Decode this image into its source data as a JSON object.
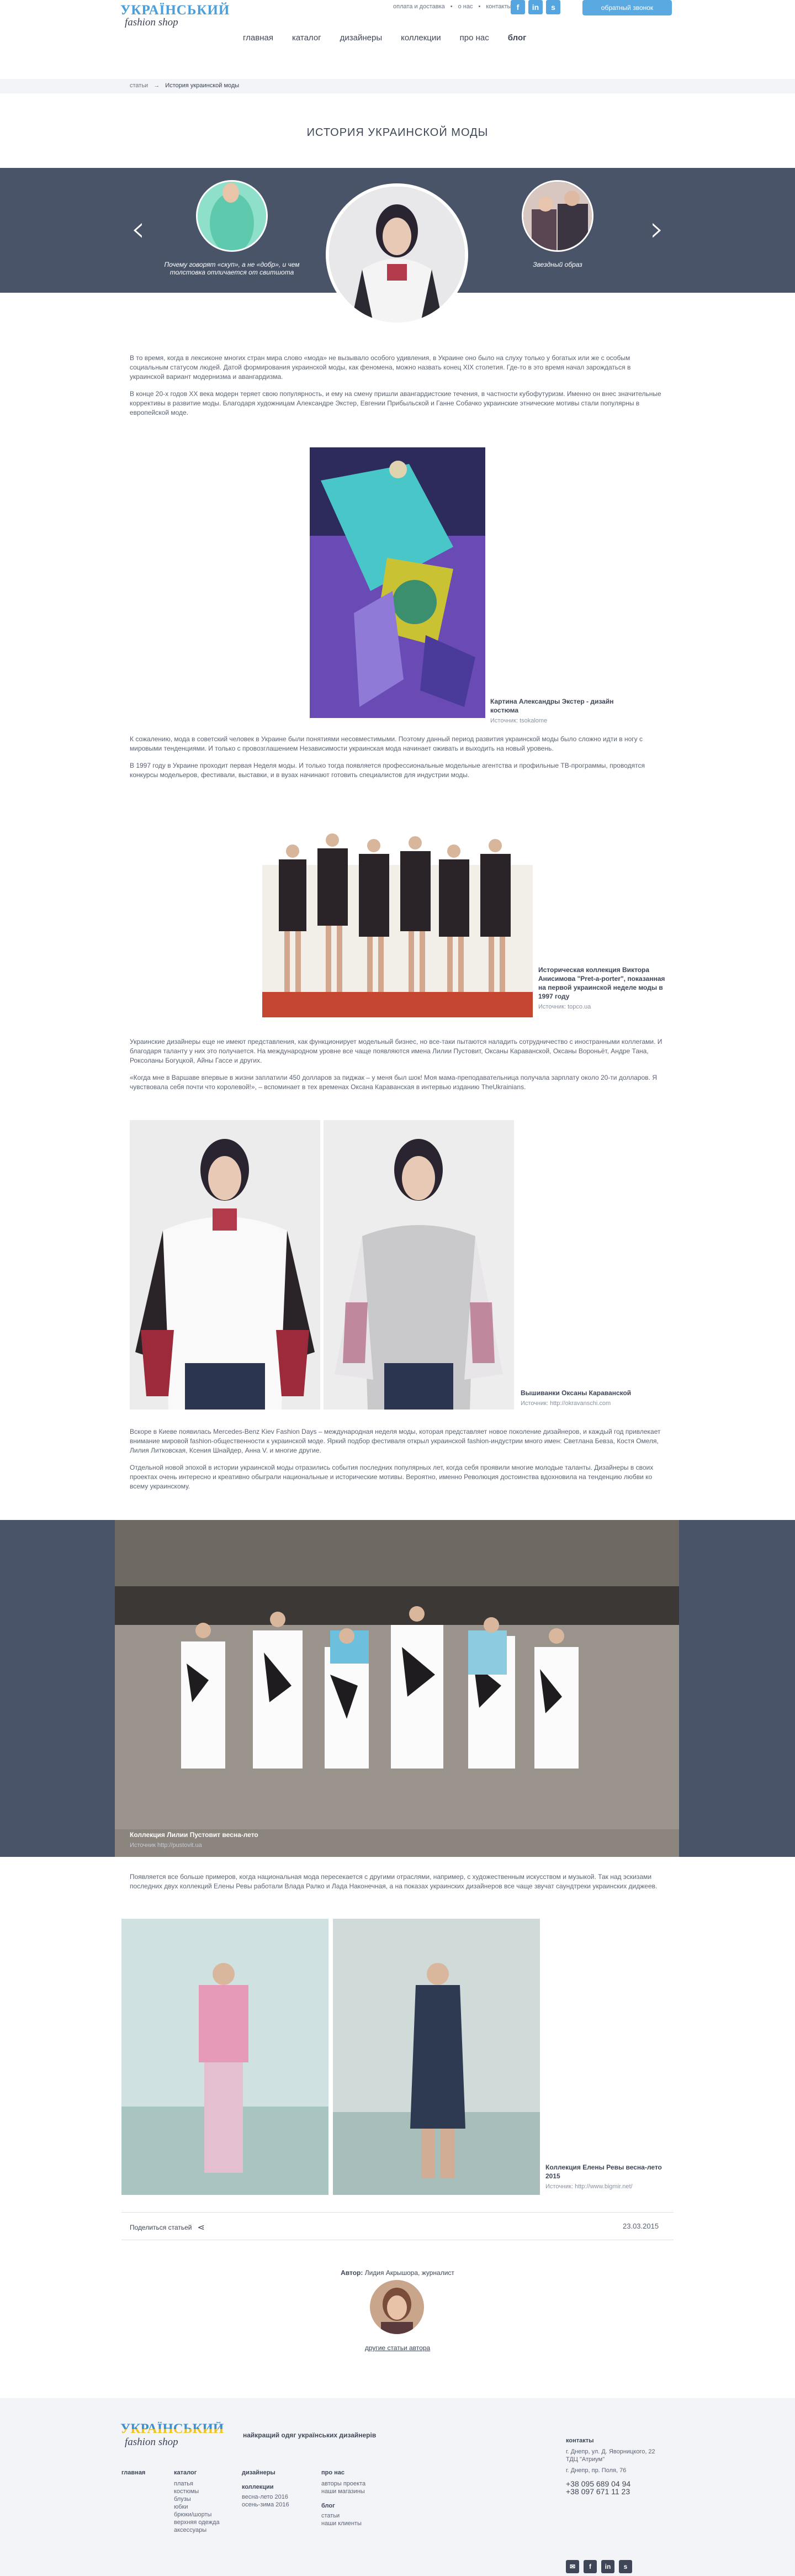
{
  "header": {
    "links": [
      "оплата и доставка",
      "о нас",
      "контакты"
    ],
    "callback_label": "обратный звонок",
    "social": [
      "f",
      "in",
      "s"
    ],
    "logo_line1": "УКРАЇНСЬКИЙ",
    "logo_line2": "fashion shop",
    "nav": [
      "главная",
      "каталог",
      "дизайнеры",
      "коллекции",
      "про нас",
      "блог"
    ]
  },
  "breadcrumb": {
    "root": "статьи",
    "current": "История украинской моды"
  },
  "page_title": "ИСТОРИЯ УКРАИНСКОЙ МОДЫ",
  "slider": {
    "prev_caption": "Почему говорят «скуп», а не «добр», и чем толстовка отличается от свитшота",
    "next_caption": "Звездный образ"
  },
  "article": {
    "p1": "В то время, когда в лексиконе многих стран мира слово «мода» не вызывало особого удивления, в Украине оно было на слуху только у богатых или же с особым социальным статусом людей. Датой формирования украинской моды, как феномена, можно назвать конец XIX столетия. Где-то в это время начал зарождаться в украинской вариант модернизма и авангардизма.",
    "p2": "В конце 20-х годов XX века модерн теряет свою популярность, и ему на смену пришли авангардистские течения, в частности кубофутуризм. Именно он внес значительные коррективы в развитие моды. Благодаря художницам Александре Экстер, Евгении Прибыльской и Ганне Собачко украинские этнические мотивы стали популярны в европейской моде.",
    "cap1_title": "Картина Александры Экстер - дизайн костюма",
    "cap1_src": "Источник: tsokalome",
    "p3": "К сожалению, мода в советский человек в Украине были понятиями несовместимыми. Поэтому данный период развития украинской моды было сложно идти в ногу с мировыми тенденциями. И только с провозглашением Независимости украинская мода начинает оживать и выходить на новый уровень.",
    "p4": "В 1997 году в Украине проходит первая Неделя моды. И только тогда появляется профессиональные модельные агентства и профильные ТВ-программы, проводятся конкурсы модельеров, фестивали, выставки, и в вузах начинают готовить специалистов для индустрии моды.",
    "cap2_title": "Историческая коллекция Виктора Анисимова \"Pret-a-porter\", показанная на первой украинской неделе моды в 1997 году",
    "cap2_src": "Источник: topco.ua",
    "p5": "Украинские дизайнеры еще не имеют представления, как функционирует модельный бизнес, но все-таки пытаются наладить сотрудничество с иностранными коллегами. И благодаря таланту у них это получается. На международном уровне все чаще появляются имена Лилии Пустовит, Оксаны Караванской, Оксаны Вороньёт, Андре Тана, Роксоланы Богуцкой, Айны Гассе и других.",
    "p6": "«Когда мне в Варшаве впервые в жизни заплатили 450 долларов за пиджак – у меня был шок! Моя мама-преподавательница получала зарплату около 20-ти долларов. Я чувствовала себя почти что королевой!», – вспоминает в тех временах Оксана Караванская в интервью изданию TheUkrainians.",
    "cap3_title": "Вышиванки Оксаны Караванской",
    "cap3_src": "Источник: http://okravanschi.com",
    "p7": "Вскоре в Киеве появилась Mercedes-Benz Kiev Fashion Days – международная неделя моды, которая представляет новое поколение дизайнеров, и каждый год привлекает внимание мировой fashion-общественности к украинской моде. Яркий подбор фестиваля открыл украинской fashion-индустрии много имен: Светлана Бевза, Костя Омеля, Лилия Литковская, Ксения Шнайдер, Анна V. и многие другие.",
    "p8": "Отдельной новой эпохой в истории украинской моды отразились события последних популярных лет, когда себя проявили многие молодые таланты. Дизайнеры в своих проектах очень интересно и креативно обыграли национальные и исторические мотивы. Вероятно, именно Революция достоинства вдохновила на тенденцию любви ко всему украинскому.",
    "cap4_title": "Коллекция Лилии Пустовит весна-лето",
    "cap4_src": "Источник http://pustovit.ua",
    "p9": "Появляется все больше примеров, когда национальная мода пересекается с другими отраслями, например, с художественным искусством и музыкой. Так над эскизами последних двух коллекций Елены Ревы работали Влада Ралко и Лада Наконечная, а на показах украинских дизайнеров все чаще звучат саундтреки украинских диджеев.",
    "cap5_title": "Коллекция Елены Ревы весна-лето 2015",
    "cap5_src": "Источник: http://www.bigmir.net/"
  },
  "share_label": "Поделиться статьей",
  "date": "23.03.2015",
  "author_label": "Автор:",
  "author_name": "Лидия Акрышора, журналист",
  "other_articles": "другие статьи автора",
  "footer": {
    "logo_line1": "УКРАЇНСЬКИЙ",
    "logo_line2": "fashion shop",
    "slogan": "найкращий одяг українських дизайнерів",
    "col_home": "главная",
    "col_catalog": "каталог",
    "catalog_items": [
      "платья",
      "костюмы",
      "блузы",
      "юбки",
      "брюки/шорты",
      "верхняя одежда",
      "аксессуары"
    ],
    "col_designers": "дизайнеры",
    "col_collections": "коллекции",
    "collections_items": [
      "весна-лето 2016",
      "осень-зима 2016"
    ],
    "col_about": "про нас",
    "about_items": [
      "авторы проекта",
      "наши магазины"
    ],
    "col_blog": "блог",
    "blog_items": [
      "статьи",
      "наши клиенты"
    ],
    "contacts_title": "контакты",
    "address1": "г. Днепр, ул. Д. Яворницкого, 22",
    "address1b": "ТДЦ \"Атриум\"",
    "address2": "г. Днепр, пр. Поля, 76",
    "phone1": "+38 095 689 04 94",
    "phone2": "+38 097 671 11 23"
  },
  "colors": {
    "accent": "#5aa9e1",
    "band": "#4a5468"
  }
}
